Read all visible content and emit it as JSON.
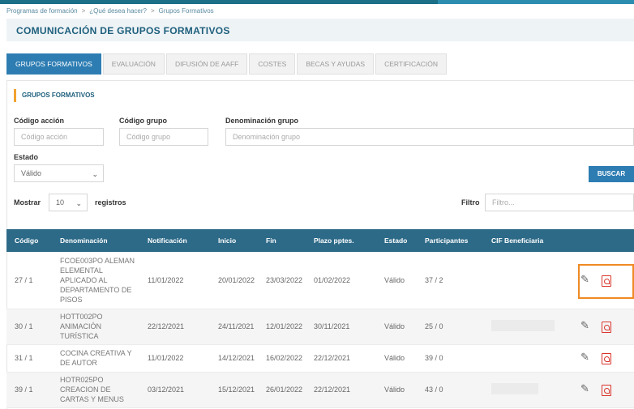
{
  "breadcrumb": [
    "Programas de formación",
    "¿Qué desea hacer?",
    "Grupos Formativos"
  ],
  "page_title": "COMUNICACIÓN DE GRUPOS FORMATIVOS",
  "tabs": [
    "GRUPOS FORMATIVOS",
    "EVALUACIÓN",
    "DIFUSIÓN DE AAFF",
    "COSTES",
    "BECAS Y AYUDAS",
    "CERTIFICACIÓN"
  ],
  "section_title": "GRUPOS FORMATIVOS",
  "filters": {
    "codigo_accion_label": "Código acción",
    "codigo_accion_placeholder": "Código acción",
    "codigo_grupo_label": "Código grupo",
    "codigo_grupo_placeholder": "Código grupo",
    "denominacion_label": "Denominación grupo",
    "denominacion_placeholder": "Denominación grupo",
    "estado_label": "Estado",
    "estado_value": "Válido",
    "buscar": "BUSCAR"
  },
  "list_controls": {
    "mostrar": "Mostrar",
    "page_size": "10",
    "registros": "registros",
    "filtro_label": "Filtro",
    "filtro_placeholder": "Filtro..."
  },
  "table": {
    "headers": [
      "Código",
      "Denominación",
      "Notificación",
      "Inicio",
      "Fin",
      "Plazo pptes.",
      "Estado",
      "Participantes",
      "CIF Beneficiaria"
    ],
    "rows": [
      {
        "codigo": "27 / 1",
        "denominacion": "FCOE003PO ALEMAN ELEMENTAL APLICADO AL DEPARTAMENTO DE PISOS",
        "notificacion": "11/01/2022",
        "inicio": "20/01/2022",
        "fin": "23/03/2022",
        "plazo": "01/02/2022",
        "estado": "Válido",
        "participantes": "37 / 2"
      },
      {
        "codigo": "30 / 1",
        "denominacion": "HOTT002PO ANIMACIÓN TURÍSTICA",
        "notificacion": "22/12/2021",
        "inicio": "24/11/2021",
        "fin": "12/01/2022",
        "plazo": "30/11/2021",
        "estado": "Válido",
        "participantes": "25 / 0"
      },
      {
        "codigo": "31 / 1",
        "denominacion": "COCINA CREATIVA Y DE AUTOR",
        "notificacion": "11/01/2022",
        "inicio": "14/12/2021",
        "fin": "16/02/2022",
        "plazo": "22/12/2021",
        "estado": "Válido",
        "participantes": "39 / 0"
      },
      {
        "codigo": "39 / 1",
        "denominacion": "HOTR025PO CREACION DE CARTAS Y MENUS",
        "notificacion": "03/12/2021",
        "inicio": "15/12/2021",
        "fin": "26/01/2022",
        "plazo": "22/12/2021",
        "estado": "Válido",
        "participantes": "43 / 0"
      }
    ]
  },
  "colors": {
    "accent": "#2d7db3",
    "header": "#2d6a88",
    "highlight": "#f08a24",
    "pdf": "#d9342b"
  }
}
